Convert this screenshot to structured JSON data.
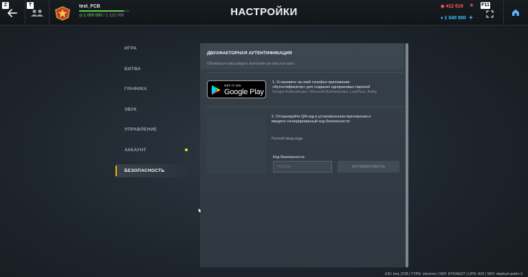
{
  "header": {
    "title": "НАСТРОЙКИ",
    "back_hotkey": "Z",
    "friends_hotkey": "T",
    "fullscreen_hotkey": "F11",
    "player": {
      "name": "test_FCB",
      "xp_current": "1 000 000",
      "xp_total": "/ 1 122 000",
      "xp_progress": 0.891
    },
    "currency": {
      "red_amount": "412 619",
      "blue_amount": "1 040 000"
    }
  },
  "nav": {
    "items": [
      {
        "label": "ИГРА"
      },
      {
        "label": "БИТВА"
      },
      {
        "label": "ГРАФИКА"
      },
      {
        "label": "ЗВУК"
      },
      {
        "label": "УПРАВЛЕНИЕ"
      },
      {
        "label": "АККАУНТ"
      },
      {
        "label": "БЕЗОПАСНОСТЬ"
      }
    ],
    "active": "БЕЗОПАСНОСТЬ"
  },
  "panel": {
    "title": "ДВУХФАКТОРНАЯ АУТЕНТИФИКАЦИЯ",
    "subtitle": "Обезопасьте ваш аккаунт, выполнив три простых шага",
    "store_badge": {
      "top": "GET IT ON",
      "main": "Google Play"
    },
    "step1": {
      "line1": "1. Установите на свой телефон приложение",
      "line2": "«Аутентификатор» для создания одноразовых паролей",
      "hint": "Google Authenticator, Microsoft Authenticator, LastPass, Authy"
    },
    "step2": {
      "line1": "2. Отсканируйте QR-код в установленном приложении и",
      "line2": "введите сгенерированный код безопасности"
    },
    "manual_entry": "Ручной ввод кода",
    "code_label": "Код безопасности",
    "code_placeholder": "000000",
    "activate_label": "АКТИВИРОВАТЬ"
  },
  "footer": {
    "text": "UID: test_FCB | TYPE: electron | VER: 8741fb027 | UPD: 818 | SRV: deployé-pubto 2"
  },
  "colors": {
    "accent_yellow": "#f5b800",
    "currency_red": "#ff5a5a",
    "currency_blue": "#38c8ff",
    "xp_green": "#5fd04e"
  },
  "icons": {
    "back": "arrow-left-icon",
    "friends": "friends-icon",
    "rank": "rank-star-icon",
    "fullscreen": "fullscreen-icon",
    "home": "home-icon"
  }
}
